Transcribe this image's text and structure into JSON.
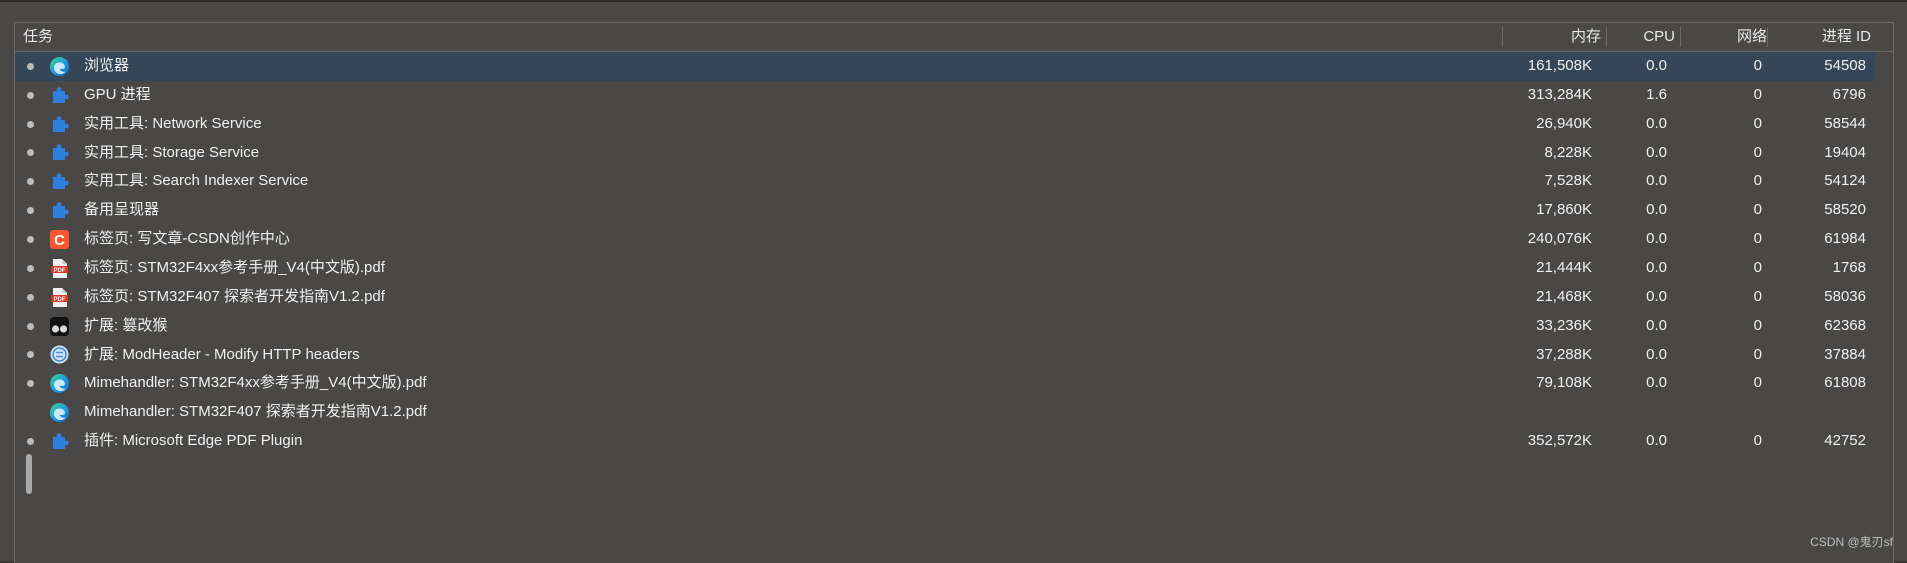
{
  "columns": {
    "task": "任务",
    "memory": "内存",
    "cpu": "CPU",
    "network": "网络",
    "pid": "进程 ID"
  },
  "rows": [
    {
      "icon": "edge-icon",
      "name": "浏览器",
      "memory": "161,508K",
      "cpu": "0.0",
      "network": "0",
      "pid": "54508",
      "selected": true
    },
    {
      "icon": "puzzle-icon",
      "name": "GPU 进程",
      "memory": "313,284K",
      "cpu": "1.6",
      "network": "0",
      "pid": "6796"
    },
    {
      "icon": "puzzle-icon",
      "name": "实用工具: Network Service",
      "memory": "26,940K",
      "cpu": "0.0",
      "network": "0",
      "pid": "58544"
    },
    {
      "icon": "puzzle-icon",
      "name": "实用工具: Storage Service",
      "memory": "8,228K",
      "cpu": "0.0",
      "network": "0",
      "pid": "19404"
    },
    {
      "icon": "puzzle-icon",
      "name": "实用工具: Search Indexer Service",
      "memory": "7,528K",
      "cpu": "0.0",
      "network": "0",
      "pid": "54124"
    },
    {
      "icon": "puzzle-icon",
      "name": "备用呈现器",
      "memory": "17,860K",
      "cpu": "0.0",
      "network": "0",
      "pid": "58520"
    },
    {
      "icon": "csdn-icon",
      "name": "标签页: 写文章-CSDN创作中心",
      "memory": "240,076K",
      "cpu": "0.0",
      "network": "0",
      "pid": "61984"
    },
    {
      "icon": "pdf-icon",
      "name": "标签页: STM32F4xx参考手册_V4(中文版).pdf",
      "memory": "21,444K",
      "cpu": "0.0",
      "network": "0",
      "pid": "1768"
    },
    {
      "icon": "pdf-icon",
      "name": "标签页: STM32F407 探索者开发指南V1.2.pdf",
      "memory": "21,468K",
      "cpu": "0.0",
      "network": "0",
      "pid": "58036"
    },
    {
      "icon": "tampermonkey-icon",
      "name": "扩展: 篡改猴",
      "memory": "33,236K",
      "cpu": "0.0",
      "network": "0",
      "pid": "62368"
    },
    {
      "icon": "modheader-icon",
      "name": "扩展: ModHeader - Modify HTTP headers",
      "memory": "37,288K",
      "cpu": "0.0",
      "network": "0",
      "pid": "37884"
    },
    {
      "icon": "edge-icon",
      "name": "Mimehandler: STM32F4xx参考手册_V4(中文版).pdf",
      "memory": "79,108K",
      "cpu": "0.0",
      "network": "0",
      "pid": "61808"
    },
    {
      "icon": "edge-icon",
      "name": "Mimehandler: STM32F407 探索者开发指南V1.2.pdf",
      "memory": "",
      "cpu": "",
      "network": "",
      "pid": ""
    },
    {
      "icon": "puzzle-icon",
      "name": "插件: Microsoft Edge PDF Plugin",
      "memory": "352,572K",
      "cpu": "0.0",
      "network": "0",
      "pid": "42752"
    }
  ],
  "watermark": "CSDN @鬼刃sf",
  "colors": {
    "background": "#494846",
    "selected_row": "#344657",
    "puzzle_blue": "#2f7fe0",
    "csdn_red": "#fc5531",
    "pdf_red": "#d9342b"
  }
}
